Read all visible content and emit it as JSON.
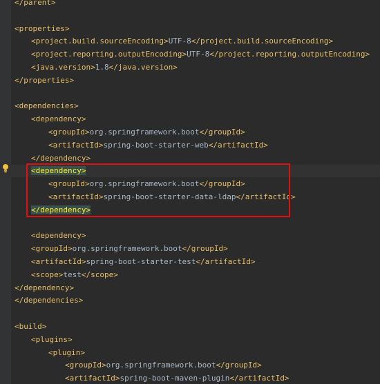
{
  "lines": [
    {
      "parts": [
        {
          "c": "tag",
          "t": "</parent>"
        }
      ]
    },
    {
      "parts": []
    },
    {
      "parts": [
        {
          "c": "tag",
          "t": "<properties>"
        }
      ]
    },
    {
      "parts": [
        {
          "c": "tag",
          "t": "<project.build.sourceEncoding>"
        },
        {
          "c": "txt",
          "t": "UTF-8"
        },
        {
          "c": "tag",
          "t": "</project.build.sourceEncoding>"
        }
      ]
    },
    {
      "parts": [
        {
          "c": "tag",
          "t": "<project.reporting.outputEncoding>"
        },
        {
          "c": "txt",
          "t": "UTF-8"
        },
        {
          "c": "tag",
          "t": "</project.reporting.outputEncoding>"
        }
      ]
    },
    {
      "parts": [
        {
          "c": "tag",
          "t": "<java.version>"
        },
        {
          "c": "txt",
          "t": "1.8"
        },
        {
          "c": "tag",
          "t": "</java.version>"
        }
      ]
    },
    {
      "parts": [
        {
          "c": "tag",
          "t": "</properties>"
        }
      ]
    },
    {
      "parts": []
    },
    {
      "parts": [
        {
          "c": "tag",
          "t": "<dependencies>"
        }
      ]
    },
    {
      "parts": [
        {
          "c": "tag",
          "t": "<dependency>"
        }
      ]
    },
    {
      "parts": [
        {
          "c": "tag",
          "t": "<groupId>"
        },
        {
          "c": "txt",
          "t": "org.springframework.boot"
        },
        {
          "c": "tag",
          "t": "</groupId>"
        }
      ]
    },
    {
      "parts": [
        {
          "c": "tag",
          "t": "<artifactId>"
        },
        {
          "c": "txt",
          "t": "spring-boot-starter-web"
        },
        {
          "c": "tag",
          "t": "</artifactId>"
        }
      ]
    },
    {
      "parts": [
        {
          "c": "tag",
          "t": "</dependency>"
        }
      ]
    },
    {
      "parts": [
        {
          "c": "match",
          "t": "<dependency>"
        }
      ]
    },
    {
      "parts": [
        {
          "c": "tag",
          "t": "<groupId>"
        },
        {
          "c": "txt",
          "t": "org.springframework.boot"
        },
        {
          "c": "tag",
          "t": "</groupId>"
        }
      ]
    },
    {
      "parts": [
        {
          "c": "tag",
          "t": "<artifactId>"
        },
        {
          "c": "txt",
          "t": "spring-boot-starter-data-ldap"
        },
        {
          "c": "tag",
          "t": "</artifactId>"
        }
      ]
    },
    {
      "parts": [
        {
          "c": "match",
          "t": "</dependency>"
        }
      ]
    },
    {
      "parts": []
    },
    {
      "parts": [
        {
          "c": "tag",
          "t": "<dependency>"
        }
      ]
    },
    {
      "parts": [
        {
          "c": "tag",
          "t": "<groupId>"
        },
        {
          "c": "txt",
          "t": "org.springframework.boot"
        },
        {
          "c": "tag",
          "t": "</groupId>"
        }
      ]
    },
    {
      "parts": [
        {
          "c": "tag",
          "t": "<artifactId>"
        },
        {
          "c": "txt",
          "t": "spring-boot-starter-test"
        },
        {
          "c": "tag",
          "t": "</artifactId>"
        }
      ]
    },
    {
      "parts": [
        {
          "c": "tag",
          "t": "<scope>"
        },
        {
          "c": "txt",
          "t": "test"
        },
        {
          "c": "tag",
          "t": "</scope>"
        }
      ]
    },
    {
      "parts": [
        {
          "c": "tag",
          "t": "</dependency>"
        }
      ]
    },
    {
      "parts": [
        {
          "c": "tag",
          "t": "</dependencies>"
        }
      ]
    },
    {
      "parts": []
    },
    {
      "parts": [
        {
          "c": "tag",
          "t": "<build>"
        }
      ]
    },
    {
      "parts": [
        {
          "c": "tag",
          "t": "<plugins>"
        }
      ]
    },
    {
      "parts": [
        {
          "c": "tag",
          "t": "<plugin>"
        }
      ]
    },
    {
      "parts": [
        {
          "c": "tag",
          "t": "<groupId>"
        },
        {
          "c": "txt",
          "t": "org.springframework.boot"
        },
        {
          "c": "tag",
          "t": "</groupId>"
        }
      ]
    },
    {
      "parts": [
        {
          "c": "tag",
          "t": "<artifactId>"
        },
        {
          "c": "txt",
          "t": "spring-boot-maven-plugin"
        },
        {
          "c": "tag",
          "t": "</artifactId>"
        }
      ]
    }
  ],
  "colors": {
    "background": "#2b2b2b",
    "tag": "#e8bf6a",
    "text": "#a9b7c6",
    "highlight_border": "#e01010",
    "current_line": "#323232",
    "brace_match": "#3b514d"
  },
  "icons": {
    "gutter": "lightbulb-icon"
  }
}
